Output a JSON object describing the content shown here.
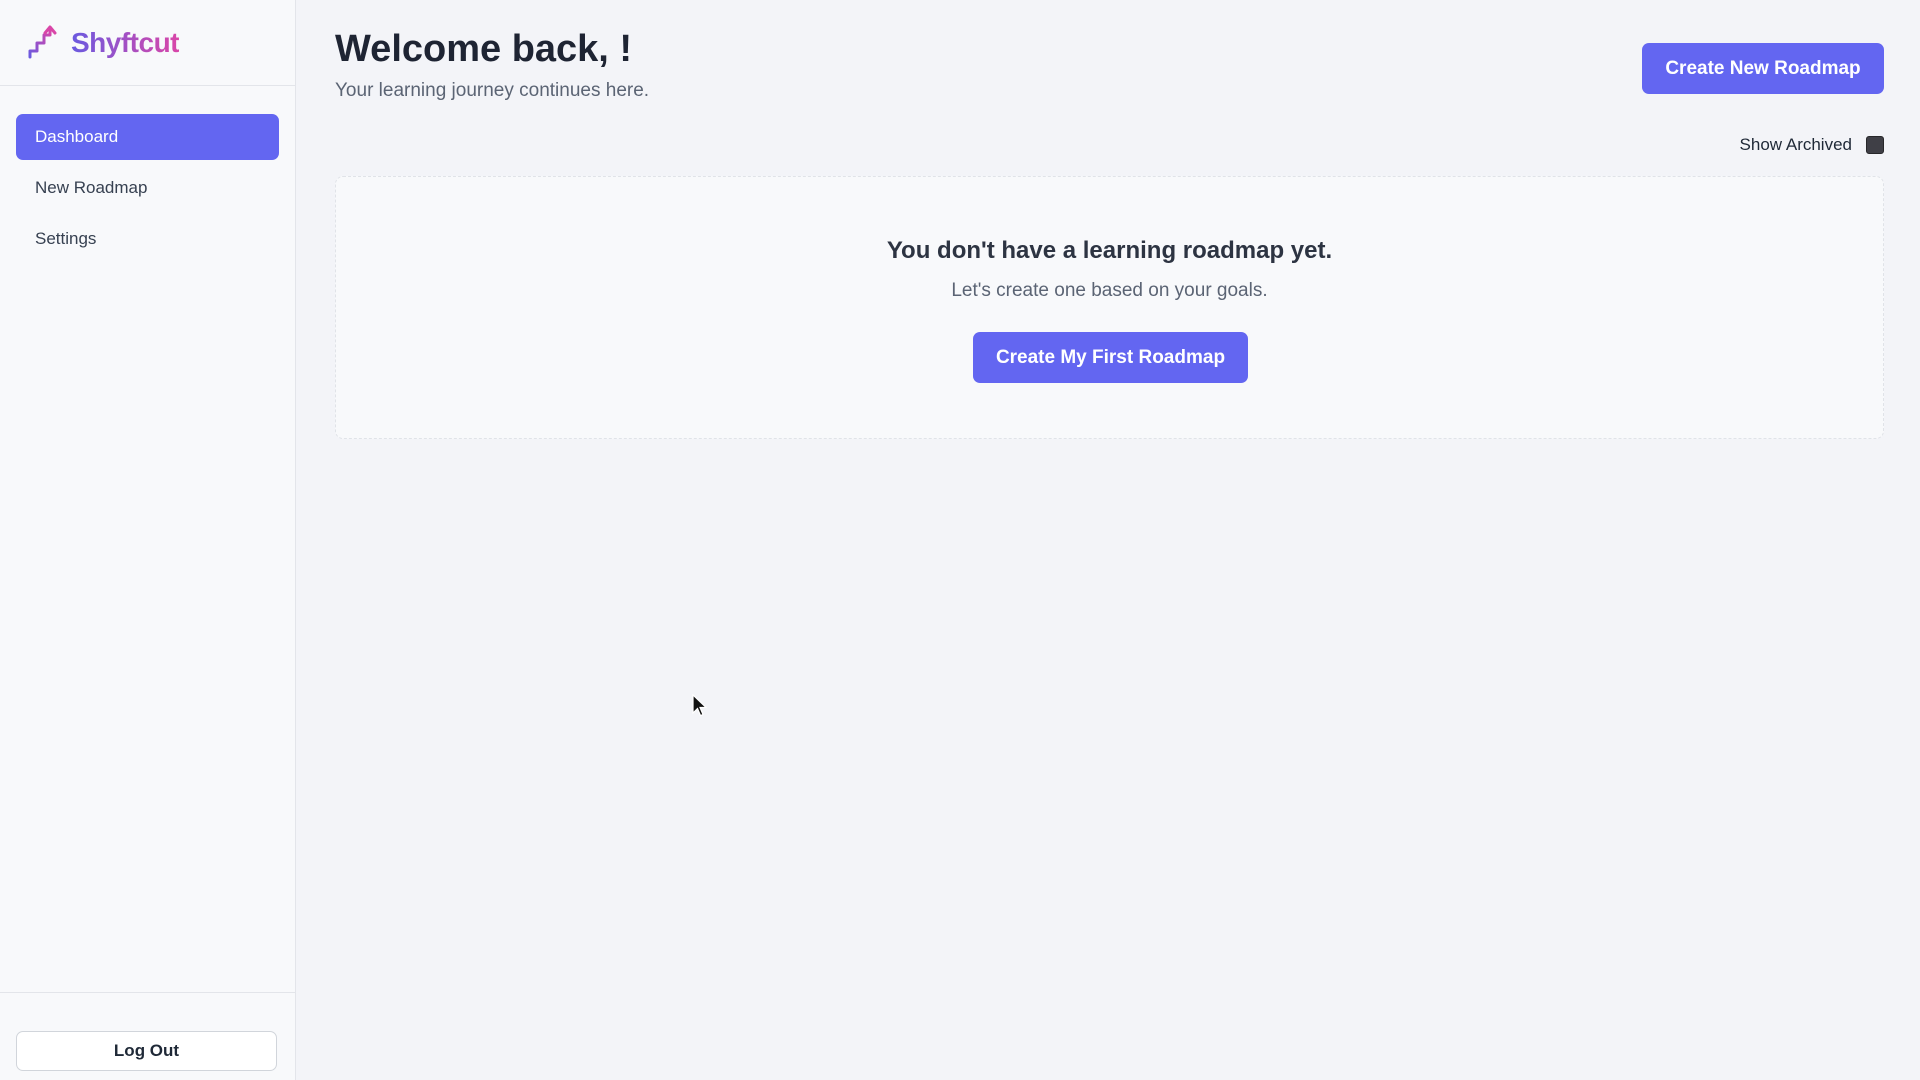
{
  "brand": {
    "name": "Shyftcut",
    "icon": "stairs-arrow-icon"
  },
  "sidebar": {
    "items": [
      {
        "label": "Dashboard",
        "active": true
      },
      {
        "label": "New Roadmap",
        "active": false
      },
      {
        "label": "Settings",
        "active": false
      }
    ],
    "logout_label": "Log Out"
  },
  "header": {
    "title": "Welcome back, !",
    "subtitle": "Your learning journey continues here.",
    "create_button": "Create New Roadmap"
  },
  "filters": {
    "show_archived_label": "Show Archived"
  },
  "empty_state": {
    "title": "You don't have a learning roadmap yet.",
    "text": "Let's create one based on your goals.",
    "button": "Create My First Roadmap"
  },
  "colors": {
    "accent": "#6366f1",
    "brand_gradient_start": "#6a5ae0",
    "brand_gradient_end": "#d946a8"
  }
}
